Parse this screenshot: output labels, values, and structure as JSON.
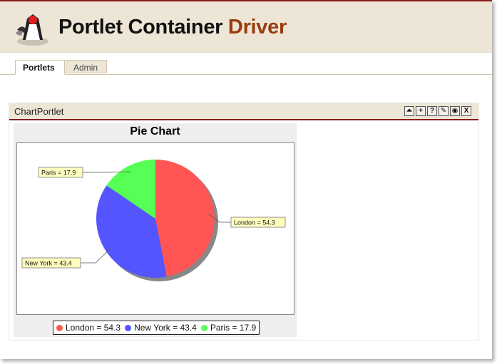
{
  "header": {
    "title_main": "Portlet Container",
    "title_accent": "Driver"
  },
  "tabs": [
    {
      "label": "Portlets",
      "active": true
    },
    {
      "label": "Admin",
      "active": false
    }
  ],
  "portlet": {
    "title": "ChartPortlet",
    "buttons": [
      {
        "icon": "minimize-icon",
        "glyph": "⏶"
      },
      {
        "icon": "maximize-icon",
        "glyph": "+"
      },
      {
        "icon": "help-icon",
        "glyph": "?"
      },
      {
        "icon": "edit-icon",
        "glyph": "✎"
      },
      {
        "icon": "view-icon",
        "glyph": "◉"
      },
      {
        "icon": "close-icon",
        "glyph": "X"
      }
    ]
  },
  "colors": {
    "header_bg": "#ede6d6",
    "accent": "#9a3b10",
    "border_red": "#8b1a1a"
  },
  "chart_data": {
    "type": "pie",
    "title": "Pie Chart",
    "categories": [
      "London",
      "New York",
      "Paris"
    ],
    "values": [
      54.3,
      43.4,
      17.9
    ],
    "colors": [
      "#ff5555",
      "#5555ff",
      "#55ff55"
    ],
    "labels": [
      "London = 54.3",
      "New York = 43.4",
      "Paris = 17.9"
    ],
    "legend": "bottom"
  }
}
